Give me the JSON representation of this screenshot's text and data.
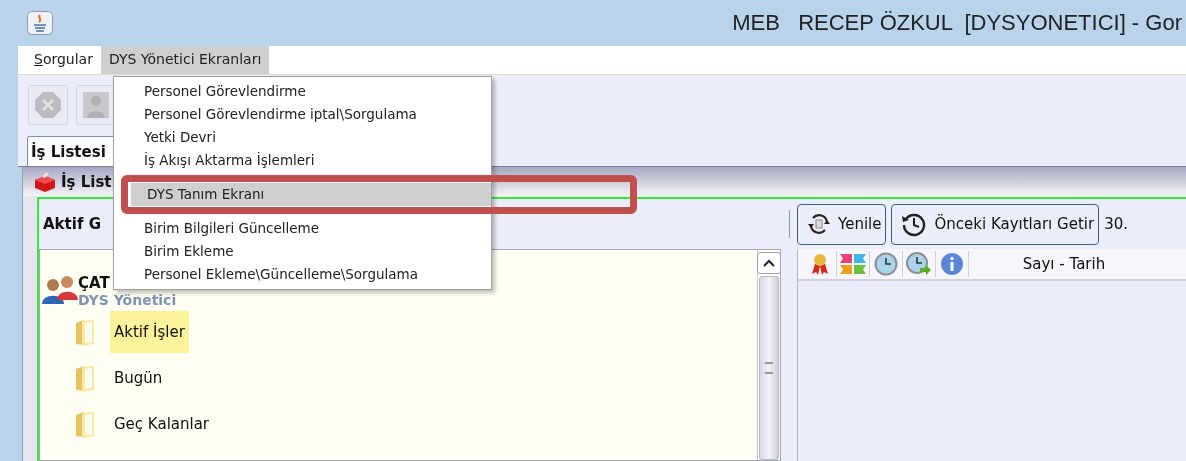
{
  "window": {
    "title": "MEB   RECEP ÖZKUL  [DYSYONETICI] - Gor"
  },
  "menu_bar": [
    {
      "label": "Sorgular",
      "selected": false
    },
    {
      "label": "DYS Yönetici Ekranları",
      "selected": true
    }
  ],
  "toolbar": [
    {
      "kind": "stop",
      "disabled": true
    },
    {
      "kind": "person",
      "disabled": true
    }
  ],
  "tabs": [
    {
      "label": "İş Listesi",
      "selected": true
    }
  ],
  "internal_frame": {
    "title": "İş List"
  },
  "left_panel": {
    "header": "Aktif G",
    "tree": {
      "label": "ÇAT",
      "subtitle": "DYS Yönetici",
      "children": [
        {
          "label": "Aktif İşler",
          "selected": true
        },
        {
          "label": "Bugün",
          "selected": false
        },
        {
          "label": "Geç Kalanlar",
          "selected": false
        }
      ]
    }
  },
  "right_panel": {
    "buttons": [
      {
        "kind": "refresh",
        "label": "Yenile"
      },
      {
        "kind": "history",
        "label": "Önceki Kayıtları Getir"
      }
    ],
    "date": "30.",
    "table": {
      "columns": [
        {
          "kind": "ribbon"
        },
        {
          "kind": "flags"
        },
        {
          "kind": "clock"
        },
        {
          "kind": "clock-arrow"
        },
        {
          "kind": "info"
        },
        {
          "kind": "text",
          "label": "Sayı - Tarih"
        }
      ]
    }
  },
  "dropdown": {
    "items": [
      {
        "label": "Personel Görevlendirme",
        "selected": false,
        "annotated": false
      },
      {
        "label": "Personel Görevlendirme iptal\\Sorgulama",
        "selected": false,
        "annotated": false
      },
      {
        "label": "Yetki Devri",
        "selected": false,
        "annotated": false
      },
      {
        "label": "İş Akışı Aktarma İşlemleri",
        "selected": false,
        "annotated": false
      },
      {
        "label": "DYS Tanım Ekranı",
        "selected": true,
        "annotated": true
      },
      {
        "label": "Birim Bilgileri Güncelleme",
        "selected": false,
        "annotated": false
      },
      {
        "label": "Birim Ekleme",
        "selected": false,
        "annotated": false
      },
      {
        "label": "Personel Ekleme\\Güncelleme\\Sorgulama",
        "selected": false,
        "annotated": false
      }
    ]
  }
}
